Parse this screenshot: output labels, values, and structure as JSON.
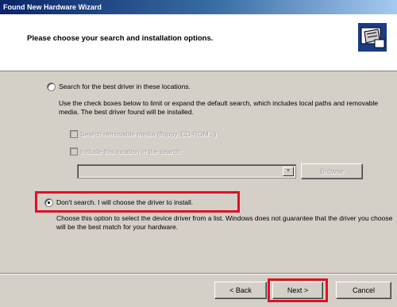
{
  "window": {
    "title": "Found New Hardware Wizard"
  },
  "header": {
    "heading": "Please choose your search and installation options."
  },
  "options": {
    "search": {
      "label": "Search for the best driver in these locations.",
      "description": "Use the check boxes below to limit or expand the default search, which includes local paths and removable media. The best driver found will be installed.",
      "checked": false,
      "search_removable_label": "Search removable media (floppy, CD-ROM...)",
      "include_location_label": "Include this location in the search:",
      "location_value": "",
      "browse_label": "Browse"
    },
    "dont_search": {
      "label": "Don't search. I will choose the driver to install.",
      "description": "Choose this option to select the device driver from a list. Windows does not guarantee that the driver you choose will be the best match for your hardware.",
      "checked": true
    }
  },
  "buttons": {
    "back": "< Back",
    "next": "Next >",
    "cancel": "Cancel"
  },
  "colors": {
    "highlight": "#e01025",
    "titlebar": "#0a246a",
    "dialog_bg": "#d4d0c8"
  }
}
